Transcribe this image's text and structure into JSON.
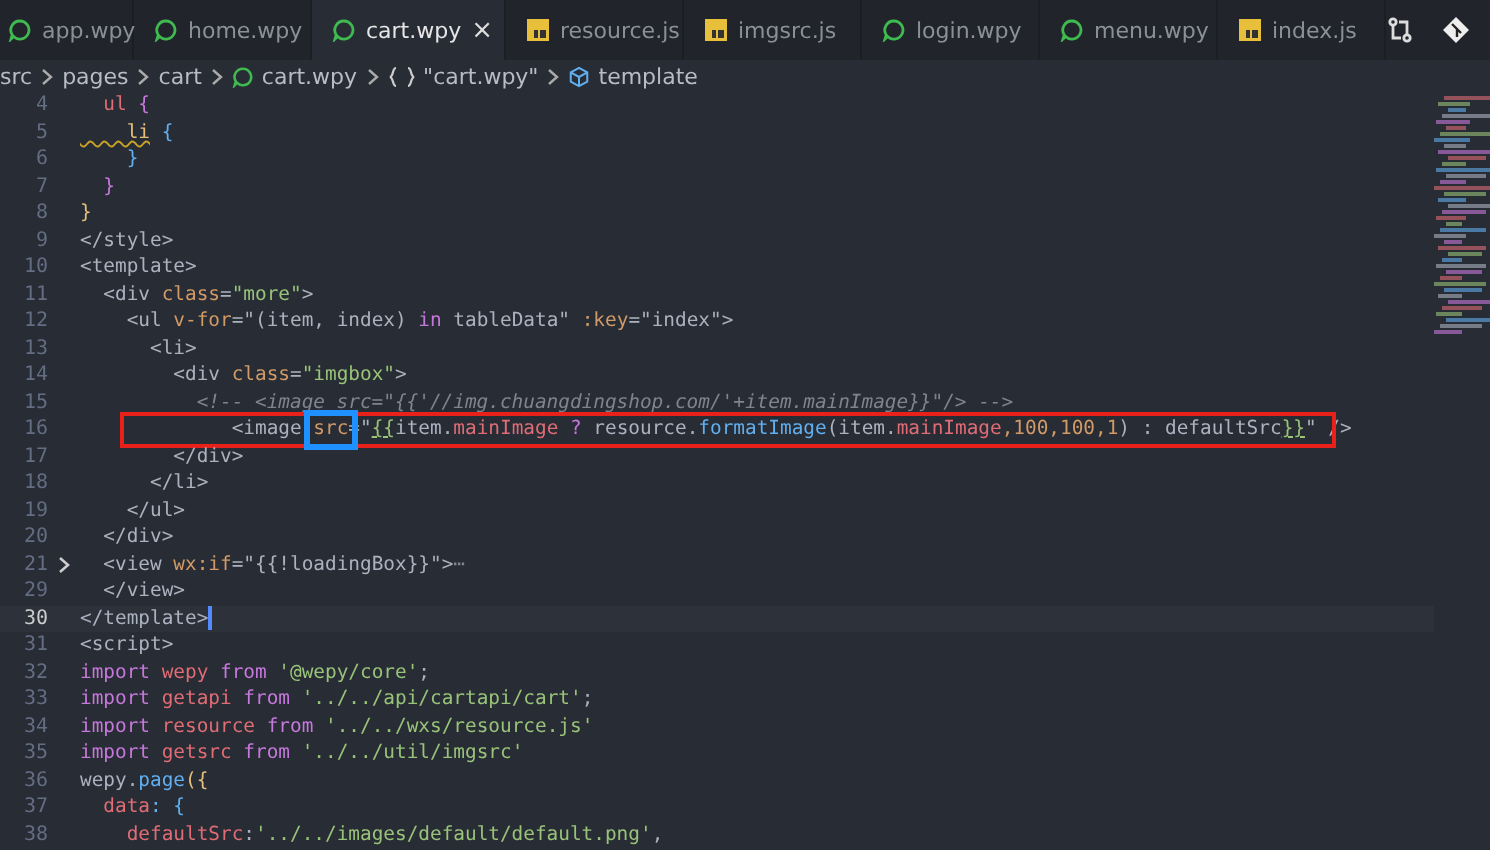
{
  "tabs": [
    {
      "label": "app.wpy",
      "kind": "wpy",
      "selected": false
    },
    {
      "label": "home.wpy",
      "kind": "wpy",
      "selected": false
    },
    {
      "label": "cart.wpy",
      "kind": "wpy",
      "selected": true,
      "close": "×"
    },
    {
      "label": "resource.js",
      "kind": "js",
      "selected": false
    },
    {
      "label": "imgsrc.js",
      "kind": "js",
      "selected": false
    },
    {
      "label": "login.wpy",
      "kind": "wpy",
      "selected": false
    },
    {
      "label": "menu.wpy",
      "kind": "wpy",
      "selected": false
    },
    {
      "label": "index.js",
      "kind": "js",
      "selected": false
    }
  ],
  "breadcrumb": [
    {
      "label": "src",
      "kind": "folder"
    },
    {
      "label": "pages",
      "kind": "folder"
    },
    {
      "label": "cart",
      "kind": "folder"
    },
    {
      "label": "cart.wpy",
      "kind": "file"
    },
    {
      "label": "\"cart.wpy\"",
      "kind": "object"
    },
    {
      "label": "template",
      "kind": "element"
    }
  ],
  "lines": [
    {
      "n": "4",
      "t": [
        {
          "text": "  ul",
          "kind": "tag"
        },
        {
          "text": " {",
          "kind": "br"
        }
      ]
    },
    {
      "n": "5",
      "t": [
        {
          "text": "    li",
          "kind": "warn"
        },
        {
          "text": " {",
          "kind": "br2"
        }
      ]
    },
    {
      "n": "6",
      "t": [
        {
          "text": "    }",
          "kind": "br2"
        }
      ]
    },
    {
      "n": "7",
      "t": [
        {
          "text": "  }",
          "kind": "br"
        }
      ]
    },
    {
      "n": "8",
      "t": [
        {
          "text": "}",
          "kind": "yel"
        }
      ]
    },
    {
      "n": "9",
      "t": [
        {
          "text": "</style>",
          "kind": "plain"
        }
      ]
    },
    {
      "n": "10",
      "t": [
        {
          "text": "<template>",
          "kind": "plain"
        }
      ]
    },
    {
      "n": "11",
      "t": [
        {
          "text": "  <div ",
          "kind": "plain"
        },
        {
          "text": "class",
          "kind": "attr"
        },
        {
          "text": "=",
          "kind": "plain"
        },
        {
          "text": "\"more\"",
          "kind": "str"
        },
        {
          "text": ">",
          "kind": "plain"
        }
      ]
    },
    {
      "n": "12",
      "t": [
        {
          "text": "    <ul ",
          "kind": "plain"
        },
        {
          "text": "v-for",
          "kind": "attr"
        },
        {
          "text": "=\"(item, index) ",
          "kind": "plain"
        },
        {
          "text": "in",
          "kind": "kw"
        },
        {
          "text": " tableData\" ",
          "kind": "plain"
        },
        {
          "text": ":key",
          "kind": "attr"
        },
        {
          "text": "=\"index\">",
          "kind": "plain"
        }
      ]
    },
    {
      "n": "13",
      "t": [
        {
          "text": "      <li>",
          "kind": "plain"
        }
      ]
    },
    {
      "n": "14",
      "t": [
        {
          "text": "        <div ",
          "kind": "plain"
        },
        {
          "text": "class",
          "kind": "attr"
        },
        {
          "text": "=",
          "kind": "plain"
        },
        {
          "text": "\"imgbox\"",
          "kind": "str"
        },
        {
          "text": ">",
          "kind": "plain"
        }
      ]
    },
    {
      "n": "15",
      "t": [
        {
          "text": "          <!-- <image src=\"{{'//img.chuangdingshop.com/'+item.mainImage}}\"/> -->",
          "kind": "comment"
        }
      ]
    },
    {
      "n": "16",
      "annotated": true,
      "t": [
        {
          "text": "             <image ",
          "kind": "plain"
        },
        {
          "text": "src",
          "kind": "attr",
          "boxed": true
        },
        {
          "text": "=\"",
          "kind": "plain"
        },
        {
          "text": "{{",
          "kind": "strU"
        },
        {
          "text": "item.",
          "kind": "plain"
        },
        {
          "text": "mainImage",
          "kind": "var"
        },
        {
          "text": " ? ",
          "kind": "kw"
        },
        {
          "text": "resource.",
          "kind": "plain"
        },
        {
          "text": "formatImage",
          "kind": "fn"
        },
        {
          "text": "(item.",
          "kind": "plain"
        },
        {
          "text": "mainImage",
          "kind": "var"
        },
        {
          "text": ",100,100,1",
          "kind": "num"
        },
        {
          "text": ") : defaultSrc",
          "kind": "plain"
        },
        {
          "text": "}}",
          "kind": "strU"
        },
        {
          "text": "\" />",
          "kind": "plain"
        }
      ]
    },
    {
      "n": "17",
      "t": [
        {
          "text": "        </div>",
          "kind": "plain"
        }
      ]
    },
    {
      "n": "18",
      "t": [
        {
          "text": "      </li>",
          "kind": "plain"
        }
      ]
    },
    {
      "n": "19",
      "t": [
        {
          "text": "    </ul>",
          "kind": "plain"
        }
      ]
    },
    {
      "n": "20",
      "t": [
        {
          "text": "  </div>",
          "kind": "plain"
        }
      ]
    },
    {
      "n": "21",
      "folded": true,
      "t": [
        {
          "text": "  <view ",
          "kind": "plain"
        },
        {
          "text": "wx:if",
          "kind": "attr"
        },
        {
          "text": "=\"{{!loadingBox}}\">",
          "kind": "plain"
        },
        {
          "text": "⋯",
          "kind": "fold"
        }
      ]
    },
    {
      "n": "29",
      "t": [
        {
          "text": "  </view>",
          "kind": "plain"
        }
      ]
    },
    {
      "n": "30",
      "current": true,
      "t": [
        {
          "text": "</template>",
          "kind": "plain"
        }
      ]
    },
    {
      "n": "31",
      "t": [
        {
          "text": "<script>",
          "kind": "plain"
        }
      ]
    },
    {
      "n": "32",
      "t": [
        {
          "text": "import",
          "kind": "kw"
        },
        {
          "text": " wepy ",
          "kind": "var"
        },
        {
          "text": "from",
          "kind": "kw"
        },
        {
          "text": " '@wepy/core'",
          "kind": "str"
        },
        {
          "text": ";",
          "kind": "plain"
        }
      ]
    },
    {
      "n": "33",
      "t": [
        {
          "text": "import",
          "kind": "kw"
        },
        {
          "text": " getapi ",
          "kind": "var"
        },
        {
          "text": "from",
          "kind": "kw"
        },
        {
          "text": " '../../api/cartapi/cart'",
          "kind": "str"
        },
        {
          "text": ";",
          "kind": "plain"
        }
      ]
    },
    {
      "n": "34",
      "t": [
        {
          "text": "import",
          "kind": "kw"
        },
        {
          "text": " resource ",
          "kind": "var"
        },
        {
          "text": "from",
          "kind": "kw"
        },
        {
          "text": " '../../wxs/resource.js'",
          "kind": "str"
        }
      ]
    },
    {
      "n": "35",
      "t": [
        {
          "text": "import",
          "kind": "kw"
        },
        {
          "text": " getsrc ",
          "kind": "var"
        },
        {
          "text": "from",
          "kind": "kw"
        },
        {
          "text": " '../../util/imgsrc'",
          "kind": "str"
        }
      ]
    },
    {
      "n": "36",
      "t": [
        {
          "text": "wepy.",
          "kind": "plain"
        },
        {
          "text": "page",
          "kind": "fn"
        },
        {
          "text": "({",
          "kind": "yel"
        }
      ]
    },
    {
      "n": "37",
      "t": [
        {
          "text": "  data",
          "kind": "var"
        },
        {
          "text": ": {",
          "kind": "br2"
        }
      ]
    },
    {
      "n": "38",
      "t": [
        {
          "text": "    defaultSrc",
          "kind": "var"
        },
        {
          "text": ":",
          "kind": "plain"
        },
        {
          "text": "'../../images/default/default.png'",
          "kind": "str"
        },
        {
          "text": ",",
          "kind": "plain"
        }
      ]
    }
  ]
}
